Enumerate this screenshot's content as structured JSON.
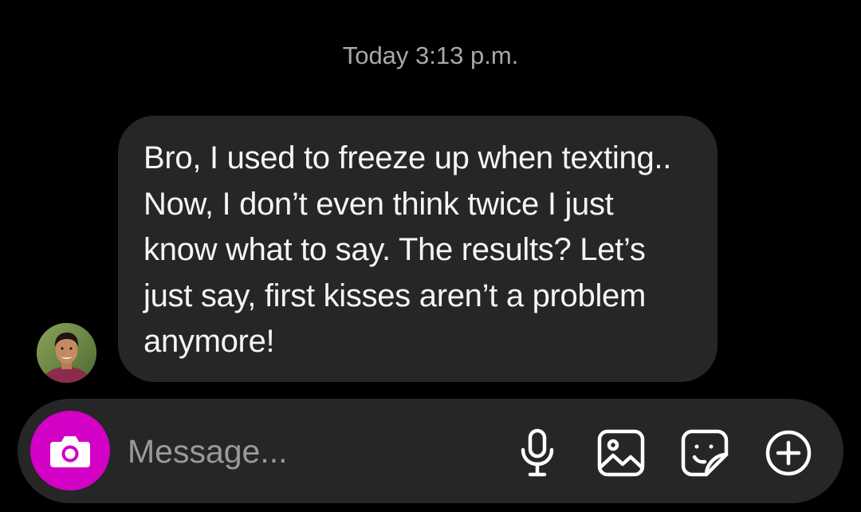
{
  "chat": {
    "timestamp": "Today 3:13 p.m.",
    "messages": [
      {
        "sender": "other",
        "text": "Bro, I used to freeze up when texting.. Now, I don’t even think twice I just know what to say. The results? Let’s just say, first kisses aren’t a problem anymore!"
      }
    ]
  },
  "composer": {
    "placeholder": "Message...",
    "value": "",
    "icons": {
      "camera": "camera-icon",
      "mic": "microphone-icon",
      "gallery": "gallery-icon",
      "sticker": "sticker-icon",
      "plus": "plus-icon"
    }
  },
  "colors": {
    "background": "#000000",
    "bubble": "#262626",
    "composer": "#262626",
    "accent": "#d300c5",
    "text": "#f5f5f5",
    "muted": "#a8a8a8"
  }
}
